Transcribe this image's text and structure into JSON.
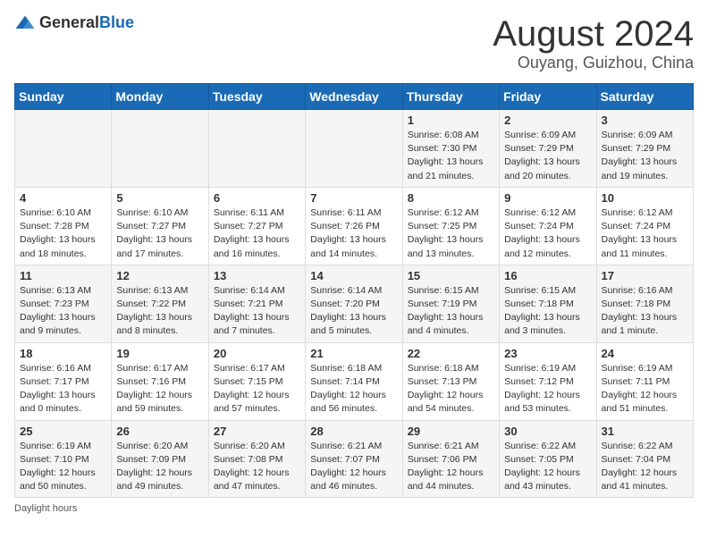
{
  "header": {
    "logo_general": "General",
    "logo_blue": "Blue",
    "month_title": "August 2024",
    "location": "Ouyang, Guizhou, China"
  },
  "days_of_week": [
    "Sunday",
    "Monday",
    "Tuesday",
    "Wednesday",
    "Thursday",
    "Friday",
    "Saturday"
  ],
  "weeks": [
    [
      {
        "day": "",
        "info": ""
      },
      {
        "day": "",
        "info": ""
      },
      {
        "day": "",
        "info": ""
      },
      {
        "day": "",
        "info": ""
      },
      {
        "day": "1",
        "info": "Sunrise: 6:08 AM\nSunset: 7:30 PM\nDaylight: 13 hours and 21 minutes."
      },
      {
        "day": "2",
        "info": "Sunrise: 6:09 AM\nSunset: 7:29 PM\nDaylight: 13 hours and 20 minutes."
      },
      {
        "day": "3",
        "info": "Sunrise: 6:09 AM\nSunset: 7:29 PM\nDaylight: 13 hours and 19 minutes."
      }
    ],
    [
      {
        "day": "4",
        "info": "Sunrise: 6:10 AM\nSunset: 7:28 PM\nDaylight: 13 hours and 18 minutes."
      },
      {
        "day": "5",
        "info": "Sunrise: 6:10 AM\nSunset: 7:27 PM\nDaylight: 13 hours and 17 minutes."
      },
      {
        "day": "6",
        "info": "Sunrise: 6:11 AM\nSunset: 7:27 PM\nDaylight: 13 hours and 16 minutes."
      },
      {
        "day": "7",
        "info": "Sunrise: 6:11 AM\nSunset: 7:26 PM\nDaylight: 13 hours and 14 minutes."
      },
      {
        "day": "8",
        "info": "Sunrise: 6:12 AM\nSunset: 7:25 PM\nDaylight: 13 hours and 13 minutes."
      },
      {
        "day": "9",
        "info": "Sunrise: 6:12 AM\nSunset: 7:24 PM\nDaylight: 13 hours and 12 minutes."
      },
      {
        "day": "10",
        "info": "Sunrise: 6:12 AM\nSunset: 7:24 PM\nDaylight: 13 hours and 11 minutes."
      }
    ],
    [
      {
        "day": "11",
        "info": "Sunrise: 6:13 AM\nSunset: 7:23 PM\nDaylight: 13 hours and 9 minutes."
      },
      {
        "day": "12",
        "info": "Sunrise: 6:13 AM\nSunset: 7:22 PM\nDaylight: 13 hours and 8 minutes."
      },
      {
        "day": "13",
        "info": "Sunrise: 6:14 AM\nSunset: 7:21 PM\nDaylight: 13 hours and 7 minutes."
      },
      {
        "day": "14",
        "info": "Sunrise: 6:14 AM\nSunset: 7:20 PM\nDaylight: 13 hours and 5 minutes."
      },
      {
        "day": "15",
        "info": "Sunrise: 6:15 AM\nSunset: 7:19 PM\nDaylight: 13 hours and 4 minutes."
      },
      {
        "day": "16",
        "info": "Sunrise: 6:15 AM\nSunset: 7:18 PM\nDaylight: 13 hours and 3 minutes."
      },
      {
        "day": "17",
        "info": "Sunrise: 6:16 AM\nSunset: 7:18 PM\nDaylight: 13 hours and 1 minute."
      }
    ],
    [
      {
        "day": "18",
        "info": "Sunrise: 6:16 AM\nSunset: 7:17 PM\nDaylight: 13 hours and 0 minutes."
      },
      {
        "day": "19",
        "info": "Sunrise: 6:17 AM\nSunset: 7:16 PM\nDaylight: 12 hours and 59 minutes."
      },
      {
        "day": "20",
        "info": "Sunrise: 6:17 AM\nSunset: 7:15 PM\nDaylight: 12 hours and 57 minutes."
      },
      {
        "day": "21",
        "info": "Sunrise: 6:18 AM\nSunset: 7:14 PM\nDaylight: 12 hours and 56 minutes."
      },
      {
        "day": "22",
        "info": "Sunrise: 6:18 AM\nSunset: 7:13 PM\nDaylight: 12 hours and 54 minutes."
      },
      {
        "day": "23",
        "info": "Sunrise: 6:19 AM\nSunset: 7:12 PM\nDaylight: 12 hours and 53 minutes."
      },
      {
        "day": "24",
        "info": "Sunrise: 6:19 AM\nSunset: 7:11 PM\nDaylight: 12 hours and 51 minutes."
      }
    ],
    [
      {
        "day": "25",
        "info": "Sunrise: 6:19 AM\nSunset: 7:10 PM\nDaylight: 12 hours and 50 minutes."
      },
      {
        "day": "26",
        "info": "Sunrise: 6:20 AM\nSunset: 7:09 PM\nDaylight: 12 hours and 49 minutes."
      },
      {
        "day": "27",
        "info": "Sunrise: 6:20 AM\nSunset: 7:08 PM\nDaylight: 12 hours and 47 minutes."
      },
      {
        "day": "28",
        "info": "Sunrise: 6:21 AM\nSunset: 7:07 PM\nDaylight: 12 hours and 46 minutes."
      },
      {
        "day": "29",
        "info": "Sunrise: 6:21 AM\nSunset: 7:06 PM\nDaylight: 12 hours and 44 minutes."
      },
      {
        "day": "30",
        "info": "Sunrise: 6:22 AM\nSunset: 7:05 PM\nDaylight: 12 hours and 43 minutes."
      },
      {
        "day": "31",
        "info": "Sunrise: 6:22 AM\nSunset: 7:04 PM\nDaylight: 12 hours and 41 minutes."
      }
    ]
  ],
  "footer": "Daylight hours"
}
